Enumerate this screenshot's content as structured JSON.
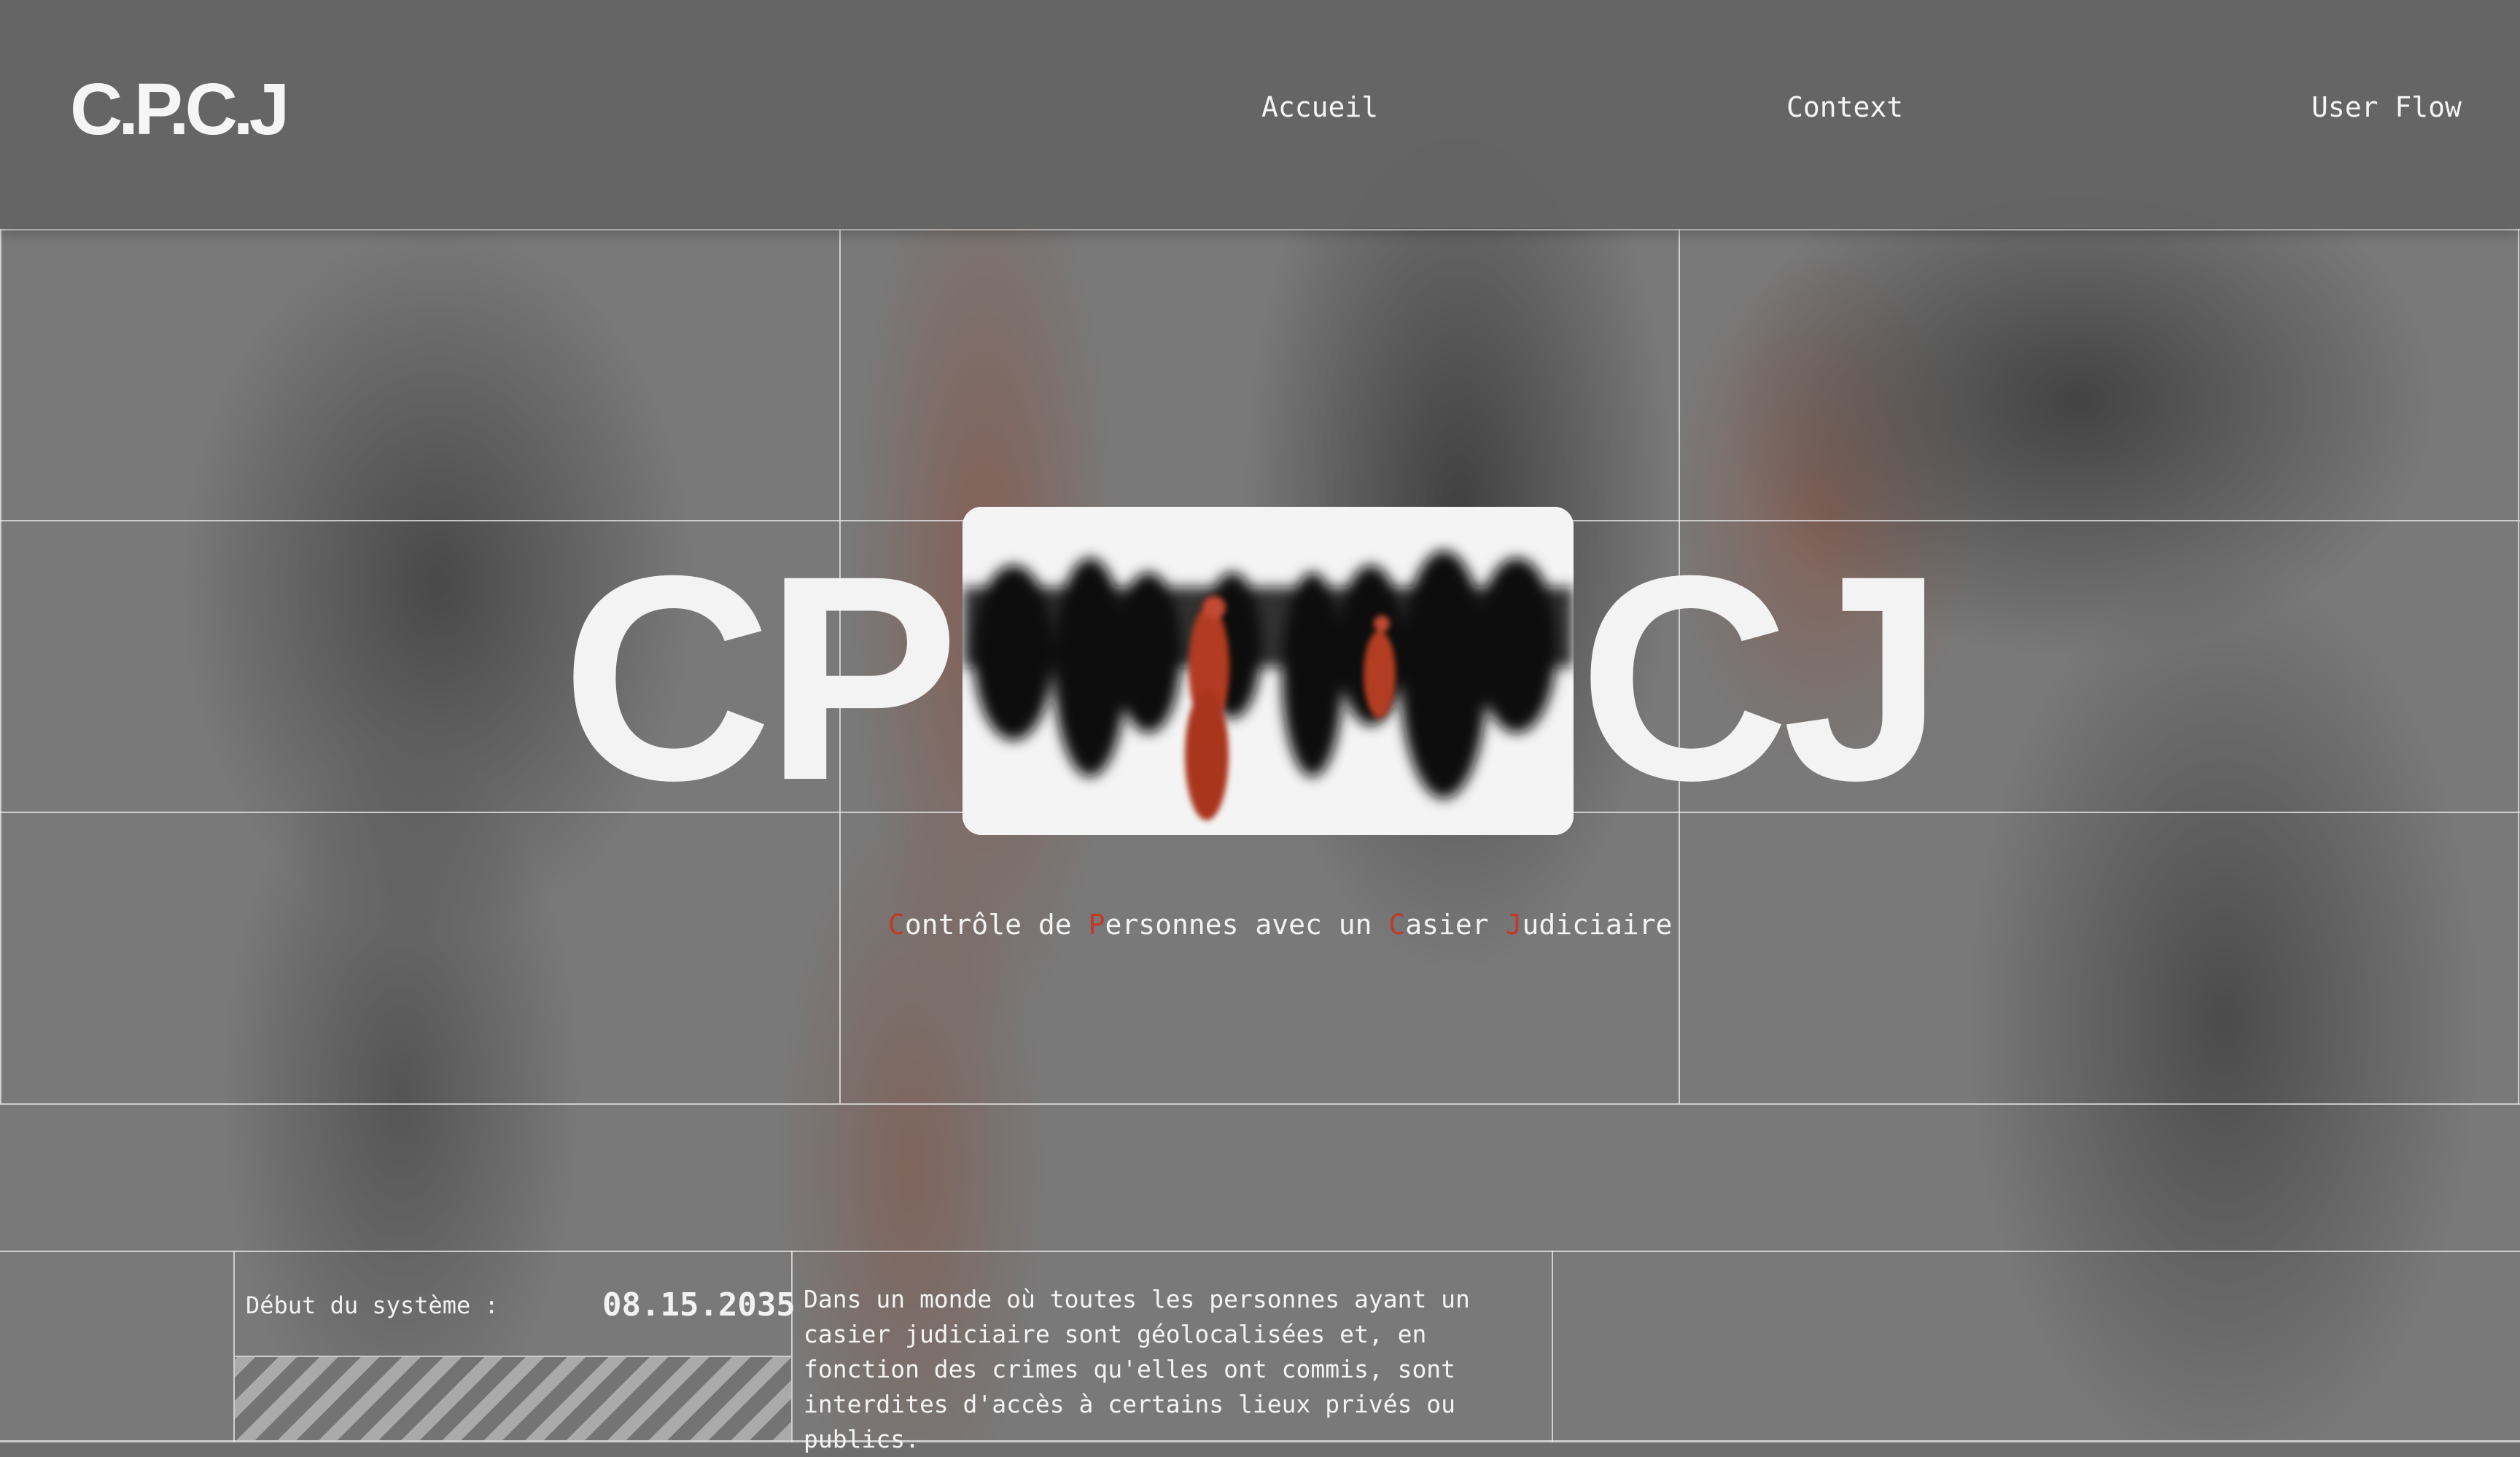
{
  "header": {
    "logo": "C.P.C.J",
    "nav": [
      "Accueil",
      "Context",
      "User Flow"
    ]
  },
  "hero": {
    "title_left": "CP",
    "title_right": "CJ",
    "subtitle": {
      "c_accent": "C",
      "c_rest": "ontrôle de ",
      "p_accent": "P",
      "p_rest": "ersonnes avec un ",
      "ca_accent": "C",
      "ca_rest": "asier ",
      "j_accent": "J",
      "j_rest": "udiciaire"
    }
  },
  "footer": {
    "start_label": "Début du système :",
    "start_date": "08.15.2035",
    "description": "Dans un monde où toutes les personnes ayant un casier judiciaire sont géolocalisées et, en fonction des crimes qu'elles ont commis, sont interdites d'accès à certains lieux privés ou publics."
  },
  "colors": {
    "accent": "#c0392b",
    "text": "#f3f3f3",
    "background": "#6e6e6e"
  }
}
